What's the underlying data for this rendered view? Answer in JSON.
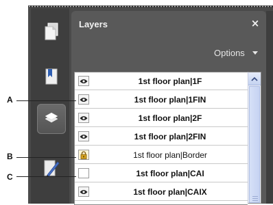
{
  "panel": {
    "title": "Layers",
    "close_label": "×",
    "options_label": "Options"
  },
  "nav": [
    {
      "name": "pages-icon",
      "active": false
    },
    {
      "name": "bookmarks-icon",
      "active": false
    },
    {
      "name": "layers-icon",
      "active": true
    },
    {
      "name": "signatures-icon",
      "active": false
    }
  ],
  "layers": [
    {
      "label": "1st floor plan|1F",
      "state": "visible",
      "bold": true
    },
    {
      "label": "1st floor plan|1FIN",
      "state": "visible",
      "bold": true
    },
    {
      "label": "1st floor plan|2F",
      "state": "visible",
      "bold": true
    },
    {
      "label": "1st floor plan|2FIN",
      "state": "visible",
      "bold": true
    },
    {
      "label": "1st floor plan|Border",
      "state": "locked",
      "bold": false
    },
    {
      "label": "1st floor plan|CAI",
      "state": "hidden",
      "bold": true
    },
    {
      "label": "1st floor plan|CAIX",
      "state": "visible",
      "bold": true
    }
  ],
  "callouts": {
    "a": "A",
    "b": "B",
    "c": "C"
  },
  "colors": {
    "panel_bg": "#595959",
    "nav_bg": "#3e3e3e",
    "list_bg": "#ffffff",
    "scroll_accent": "#c6d3f2"
  }
}
